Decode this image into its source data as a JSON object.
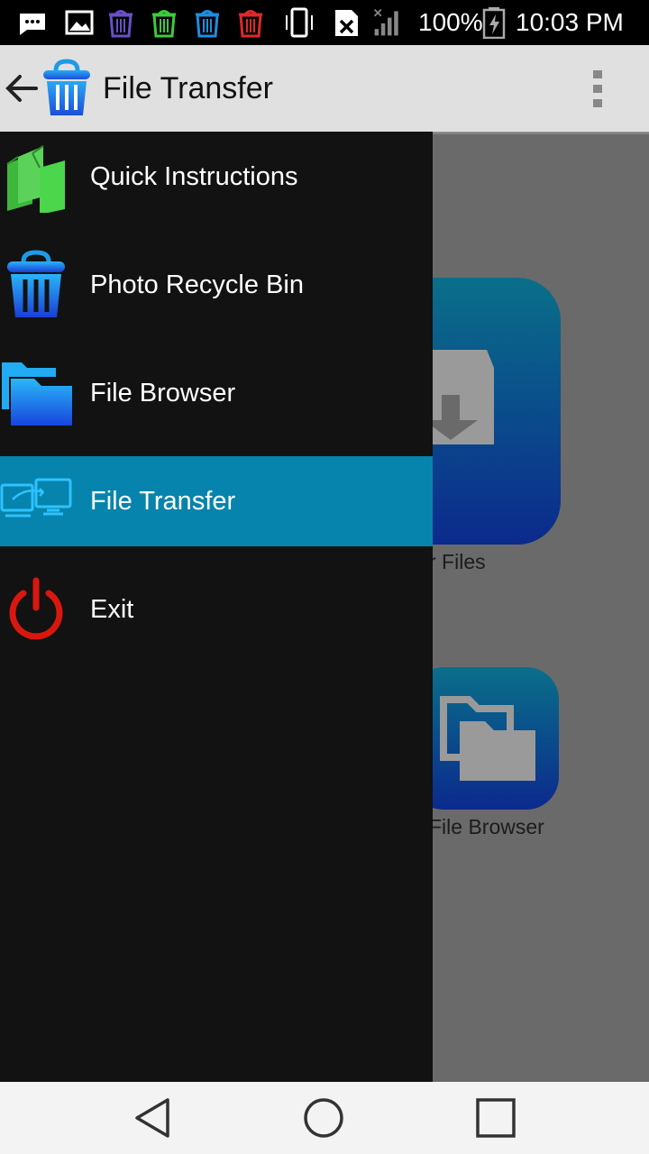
{
  "status_bar": {
    "battery_text": "100%",
    "time": "10:03 PM",
    "icons": [
      "chat-bubble-icon",
      "image-icon",
      "recycle-bin-purple-icon",
      "recycle-bin-green-icon",
      "recycle-bin-blue-icon",
      "recycle-bin-red-icon",
      "vibrate-icon",
      "no-sim-icon",
      "signal-icon",
      "battery-charging-icon"
    ]
  },
  "app_bar": {
    "title": "File Transfer",
    "icons": [
      "back-arrow-icon",
      "recycle-bin-icon",
      "overflow-menu-icon"
    ]
  },
  "background": {
    "tile_1_label": "r Files",
    "tile_2_label": "File Browser"
  },
  "drawer": {
    "items": [
      {
        "label": "Quick Instructions",
        "icon": "books-icon",
        "active": false
      },
      {
        "label": "Photo Recycle Bin",
        "icon": "recycle-bin-icon",
        "active": false
      },
      {
        "label": "File Browser",
        "icon": "folder-icon",
        "active": false
      },
      {
        "label": "File Transfer",
        "icon": "computer-transfer-icon",
        "active": true
      },
      {
        "label": "Exit",
        "icon": "power-icon",
        "active": false
      }
    ],
    "active_color": "#0684ad"
  },
  "nav_bar": {
    "icons": [
      "back-triangle-icon",
      "home-circle-icon",
      "recents-square-icon"
    ]
  }
}
